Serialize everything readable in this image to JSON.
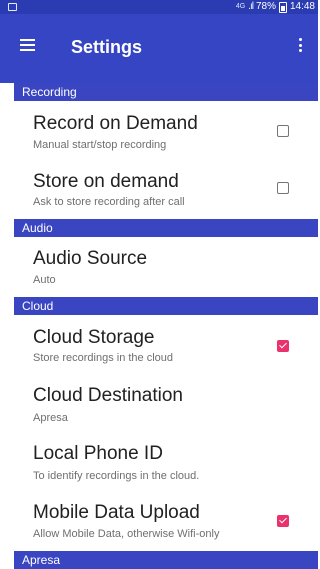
{
  "status_bar": {
    "network": "4G",
    "battery_percent": "78%",
    "time": "14:48"
  },
  "app_bar": {
    "title": "Settings",
    "menu_icon": "hamburger-menu-icon",
    "overflow_icon": "more-vert-icon"
  },
  "sections": {
    "recording": "Recording",
    "audio": "Audio",
    "cloud": "Cloud",
    "apresa": "Apresa"
  },
  "items": {
    "record_on_demand": {
      "title": "Record on Demand",
      "subtitle": "Manual start/stop recording",
      "checked": false
    },
    "store_on_demand": {
      "title": "Store on demand",
      "subtitle": "Ask to store recording after call",
      "checked": false
    },
    "audio_source": {
      "title": "Audio Source",
      "subtitle": "Auto"
    },
    "cloud_storage": {
      "title": "Cloud Storage",
      "subtitle": "Store recordings in the cloud",
      "checked": true
    },
    "cloud_destination": {
      "title": "Cloud Destination",
      "subtitle": "Apresa"
    },
    "local_phone_id": {
      "title": "Local Phone ID",
      "subtitle": "To identify recordings in the cloud."
    },
    "mobile_data_upload": {
      "title": "Mobile Data Upload",
      "subtitle": "Allow Mobile Data, otherwise Wifi-only",
      "checked": true
    }
  },
  "colors": {
    "primary": "#3545c4",
    "status_bar": "#2b3cb3",
    "section_header": "#3a45c2",
    "accent": "#e8336f"
  }
}
